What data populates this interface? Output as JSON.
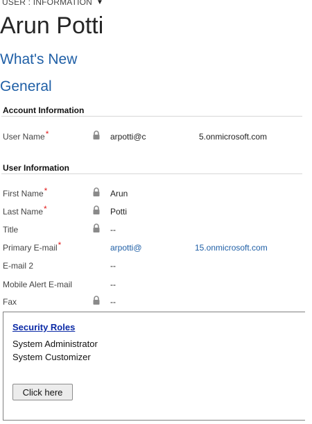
{
  "header": {
    "entity_label": "USER : INFORMATION",
    "record_name": "Arun Potti"
  },
  "nav": {
    "whats_new": "What's New",
    "general": "General"
  },
  "account_information": {
    "title": "Account Information",
    "user_name": {
      "label": "User Name",
      "required_mark": "*",
      "value_part1": "arpotti@c",
      "value_part2": "5.onmicrosoft.com",
      "locked": true
    }
  },
  "user_information": {
    "title": "User Information",
    "fields": [
      {
        "label": "First Name",
        "required_mark": "*",
        "value": "Arun",
        "locked": true
      },
      {
        "label": "Last Name",
        "required_mark": "*",
        "value": "Potti",
        "locked": true
      },
      {
        "label": "Title",
        "required_mark": "",
        "value": "--",
        "locked": true
      },
      {
        "label": "Primary E-mail",
        "required_mark": "*",
        "value": "arpotti@",
        "value_part2": "15.onmicrosoft.com",
        "locked": false
      },
      {
        "label": "E-mail 2",
        "required_mark": "",
        "value": "--",
        "locked": false
      },
      {
        "label": "Mobile Alert E-mail",
        "required_mark": "",
        "value": "--",
        "locked": false
      },
      {
        "label": "Fax",
        "required_mark": "",
        "value": "--",
        "locked": true
      }
    ]
  },
  "security_roles": {
    "title": "Security Roles",
    "roles": [
      "System Administrator",
      "System Customizer"
    ],
    "button_label": "Click here"
  },
  "colors": {
    "link_blue": "#1f5fa6",
    "required_red": "#e21c1c",
    "roles_title_blue": "#0b2aa6"
  },
  "icons": {
    "lock": "lock-icon",
    "caret": "chevron-down-icon"
  }
}
